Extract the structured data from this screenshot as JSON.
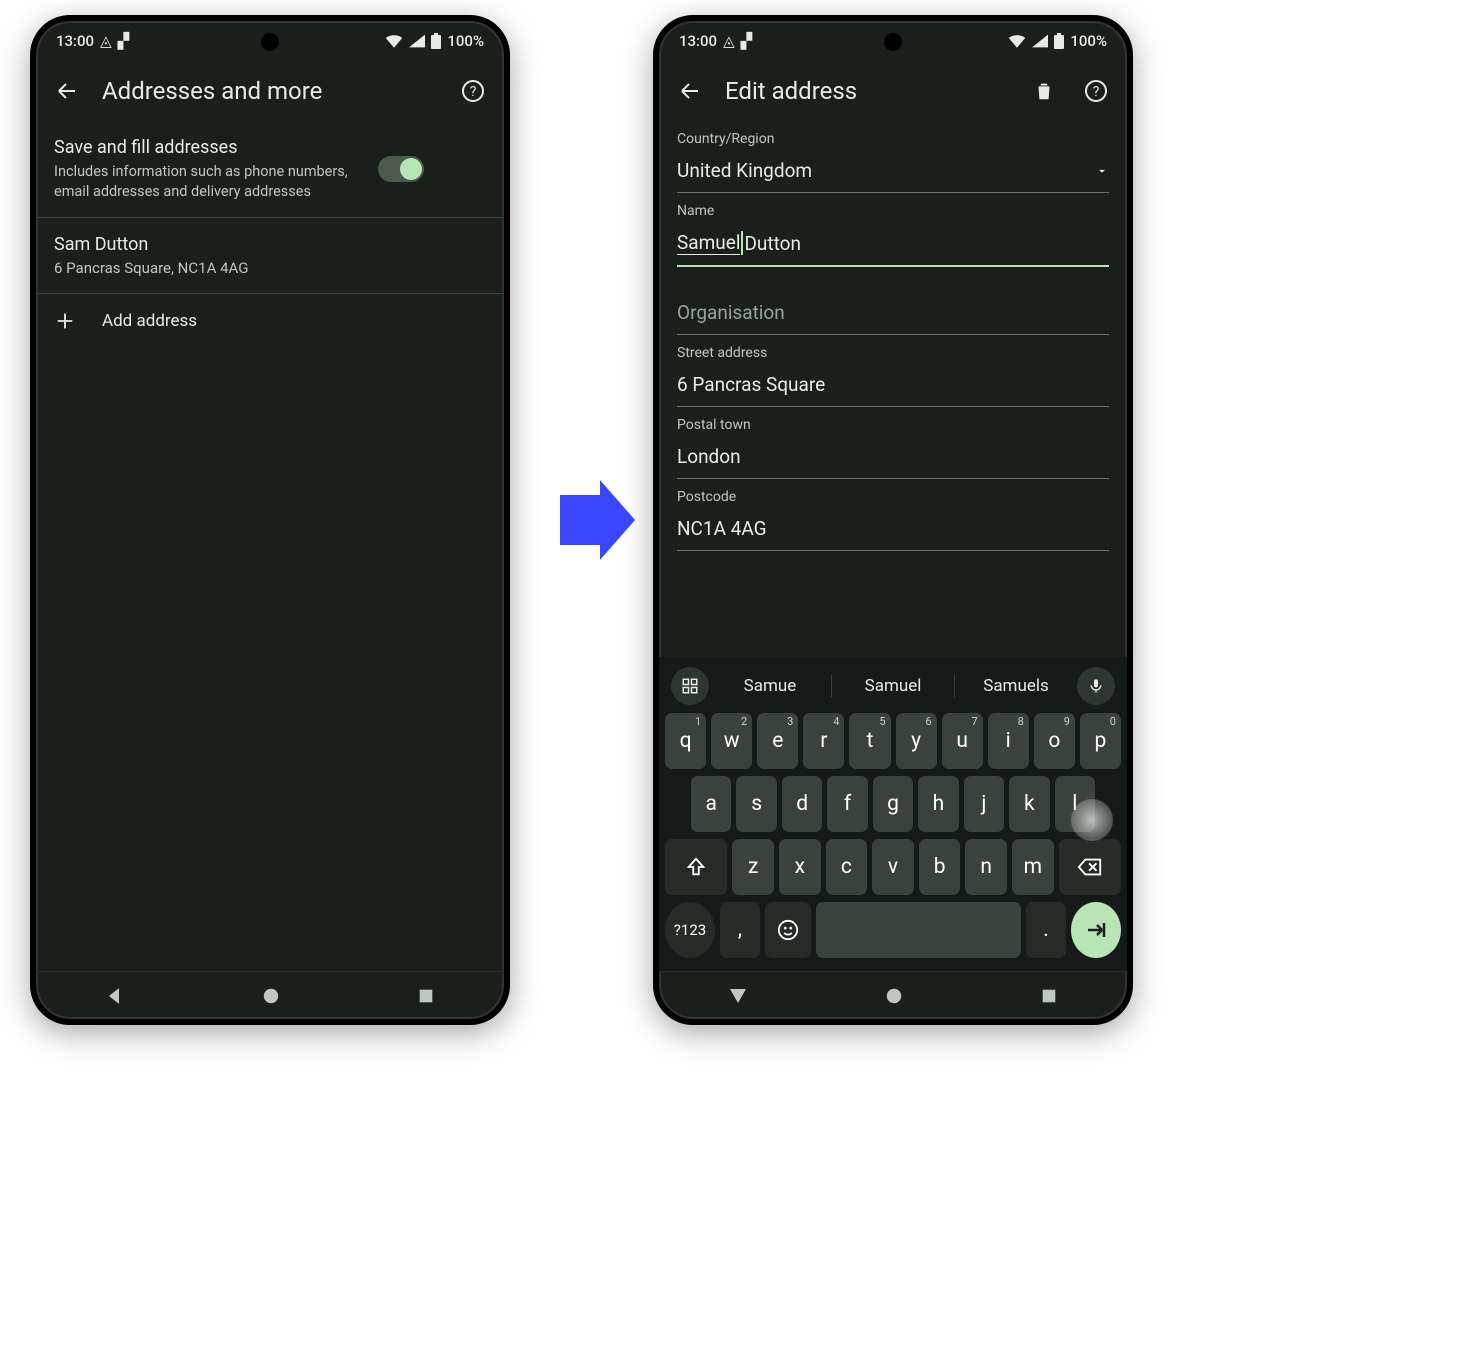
{
  "status": {
    "time": "13:00",
    "battery": "100%"
  },
  "left": {
    "title": "Addresses and more",
    "save_title": "Save and fill addresses",
    "save_desc": "Includes information such as phone numbers, email addresses and delivery addresses",
    "addr_name": "Sam Dutton",
    "addr_line": "6 Pancras Square, NC1A 4AG",
    "add_label": "Add address"
  },
  "right": {
    "title": "Edit address",
    "labels": {
      "country": "Country/Region",
      "name": "Name",
      "org": "Organisation",
      "street": "Street address",
      "town": "Postal town",
      "postcode": "Postcode"
    },
    "values": {
      "country": "United Kingdom",
      "name_first": "Samuel",
      "name_rest": " Dutton",
      "street": "6 Pancras Square",
      "town": "London",
      "postcode": "NC1A 4AG"
    }
  },
  "kbd": {
    "sugg": [
      "Samue",
      "Samuel",
      "Samuels"
    ],
    "row1": [
      "q",
      "w",
      "e",
      "r",
      "t",
      "y",
      "u",
      "i",
      "o",
      "p"
    ],
    "row1sup": [
      "1",
      "2",
      "3",
      "4",
      "5",
      "6",
      "7",
      "8",
      "9",
      "0"
    ],
    "row2": [
      "a",
      "s",
      "d",
      "f",
      "g",
      "h",
      "j",
      "k",
      "l"
    ],
    "row3": [
      "z",
      "x",
      "c",
      "v",
      "b",
      "n",
      "m"
    ],
    "numkey": "?123",
    "comma": ",",
    "period": "."
  }
}
